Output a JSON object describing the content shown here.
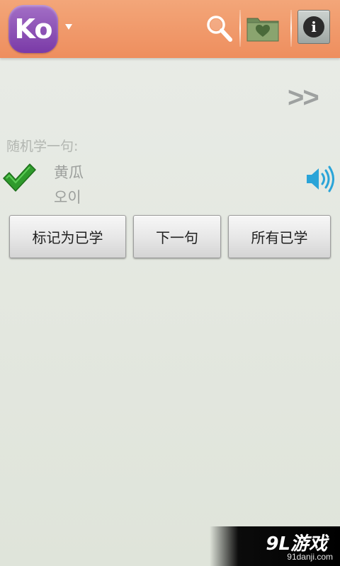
{
  "header": {
    "app_logo_text": "Ko",
    "icons": {
      "menu": "dropdown-arrow-icon",
      "search": "search-icon",
      "favorites": "favorites-folder-icon",
      "info": "info-icon"
    },
    "colors": {
      "bar": "#ef915f",
      "logo": "#8a4ab3"
    }
  },
  "content": {
    "next_label": ">>",
    "section_label": "随机学一句:",
    "sentence": {
      "chinese": "黄瓜",
      "korean": "오이",
      "status_icon": "checkmark-icon",
      "audio_icon": "speaker-icon"
    }
  },
  "buttons": {
    "mark_learned": "标记为已学",
    "next_sentence": "下一句",
    "all_learned": "所有已学"
  },
  "watermark": {
    "title": "9L游戏",
    "url": "91danji.com"
  }
}
